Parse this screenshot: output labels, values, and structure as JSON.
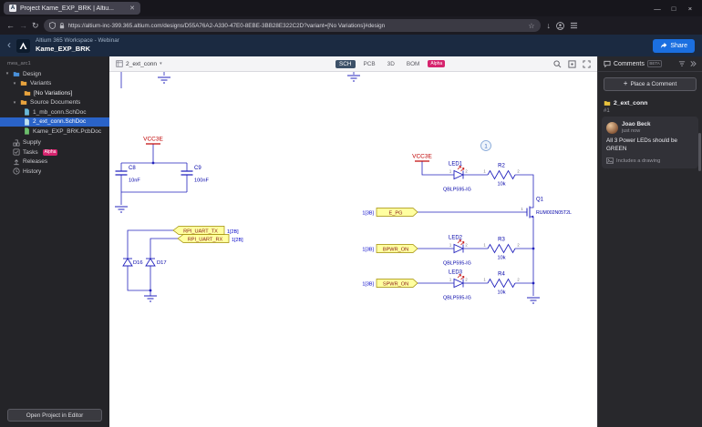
{
  "colors": {
    "accent_blue": "#1b6fe0",
    "alpha_pink": "#d6246e",
    "selection_blue": "#2a63c8",
    "wire_blue": "#2323bd",
    "power_red": "#bf0000",
    "port_fill": "#ffffa0"
  },
  "browser": {
    "tab_title": "Project Kame_EXP_BRK | Altiu...",
    "url": "https://altium-inc-399.365.altium.com/designs/D55A76A2-A330-47E0-8EBE-3BB28E322C2D?variant=[No Variations]#design",
    "window": {
      "minimize": "—",
      "maximize": "□",
      "close": "×"
    }
  },
  "app_header": {
    "workspace": "Altium 365 Workspace - Webinar",
    "project": "Kame_EXP_BRK",
    "share": "Share"
  },
  "sidebar": {
    "top_label": "mea_arc1",
    "tree": [
      {
        "label": "Design"
      },
      {
        "label": "Variants"
      },
      {
        "label": "[No Variations]"
      },
      {
        "label": "Source Documents"
      },
      {
        "label": "1_mb_conn.SchDoc"
      },
      {
        "label": "2_ext_conn.SchDoc"
      },
      {
        "label": "Kame_EXP_BRK.PcbDoc"
      },
      {
        "label": "Supply"
      },
      {
        "label": "Tasks",
        "badge": "Alpha"
      },
      {
        "label": "Releases"
      },
      {
        "label": "History"
      }
    ],
    "open_button": "Open Project in Editor"
  },
  "viewer_toolbar": {
    "document": "2_ext_conn",
    "tabs": [
      {
        "label": "SCH"
      },
      {
        "label": "PCB"
      },
      {
        "label": "3D"
      },
      {
        "label": "BOM"
      }
    ],
    "alpha_badge": "Alpha"
  },
  "schematic": {
    "power_net": "VCC3E",
    "comment_marker": "1",
    "pins": {
      "p1": "1",
      "p2": "2"
    },
    "components": [
      {
        "ref": "C8",
        "value": "10nF"
      },
      {
        "ref": "C9",
        "value": "100nF"
      },
      {
        "ref": "D16"
      },
      {
        "ref": "D17"
      },
      {
        "ref": "LED1",
        "part": "QBLP595-IG"
      },
      {
        "ref": "R2",
        "value": "10k"
      },
      {
        "ref": "Q1",
        "part": "RUM002N05T2L"
      },
      {
        "ref": "LED2",
        "part": "QBLP595-IG"
      },
      {
        "ref": "R3",
        "value": "10k"
      },
      {
        "ref": "LED3",
        "part": "QBLP595-IG"
      },
      {
        "ref": "R4",
        "value": "10k"
      }
    ],
    "ports": [
      {
        "name": "RPI_UART_TX",
        "ref": "1[2B]"
      },
      {
        "name": "RPI_UART_RX",
        "ref": "1[2B]"
      },
      {
        "name": "E_PG",
        "ref": "1[3B]"
      },
      {
        "name": "BPWR_ON",
        "ref": "1[3B]"
      },
      {
        "name": "SPWR_ON",
        "ref": "1[3B]"
      }
    ]
  },
  "comments_panel": {
    "title": "Comments",
    "beta": "BETA",
    "place_button": "Place a Comment",
    "thread": {
      "doc": "2_ext_conn",
      "id": "#1",
      "author": "Joao Beck",
      "time": "just now",
      "body": "All 3 Power LEDs should be GREEN",
      "attachment": "Includes a drawing"
    }
  }
}
